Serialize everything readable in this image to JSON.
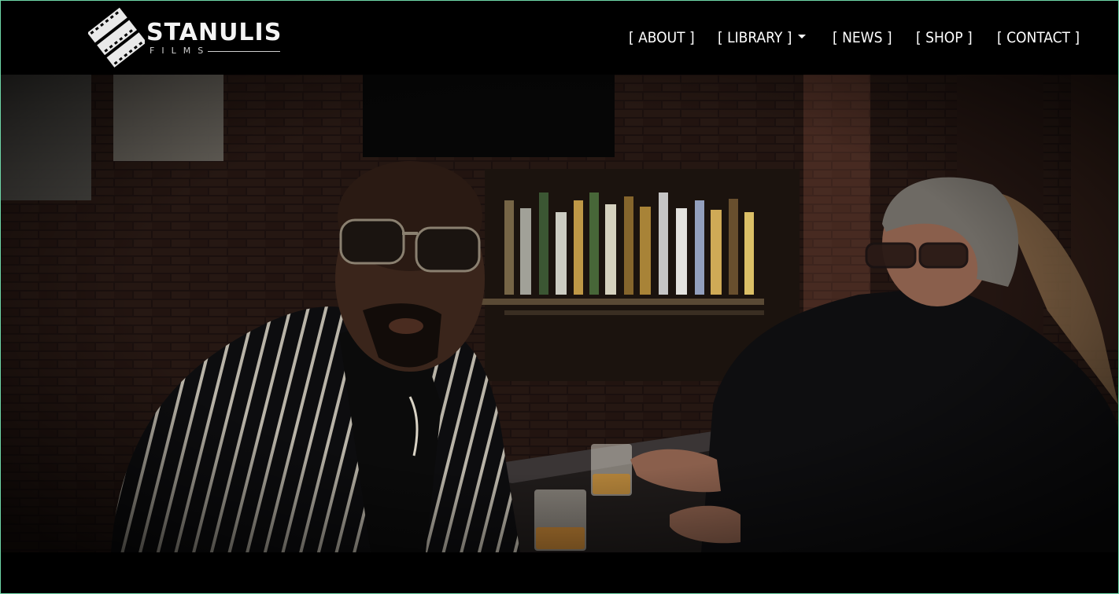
{
  "brand": {
    "name": "STANULIS",
    "sub": "FILMS"
  },
  "nav": {
    "items": [
      {
        "label": "[ ABOUT ]"
      },
      {
        "label": "[ LIBRARY ]",
        "has_dropdown": true
      },
      {
        "label": "[ NEWS ]"
      },
      {
        "label": "[ SHOP ]"
      },
      {
        "label": "[ CONTACT ]"
      }
    ]
  },
  "hero": {
    "icon": "photo-still-bar-scene"
  },
  "colors": {
    "header_bg": "#000000",
    "nav_text": "#ffffff",
    "frame_border": "#6fd7a8"
  }
}
